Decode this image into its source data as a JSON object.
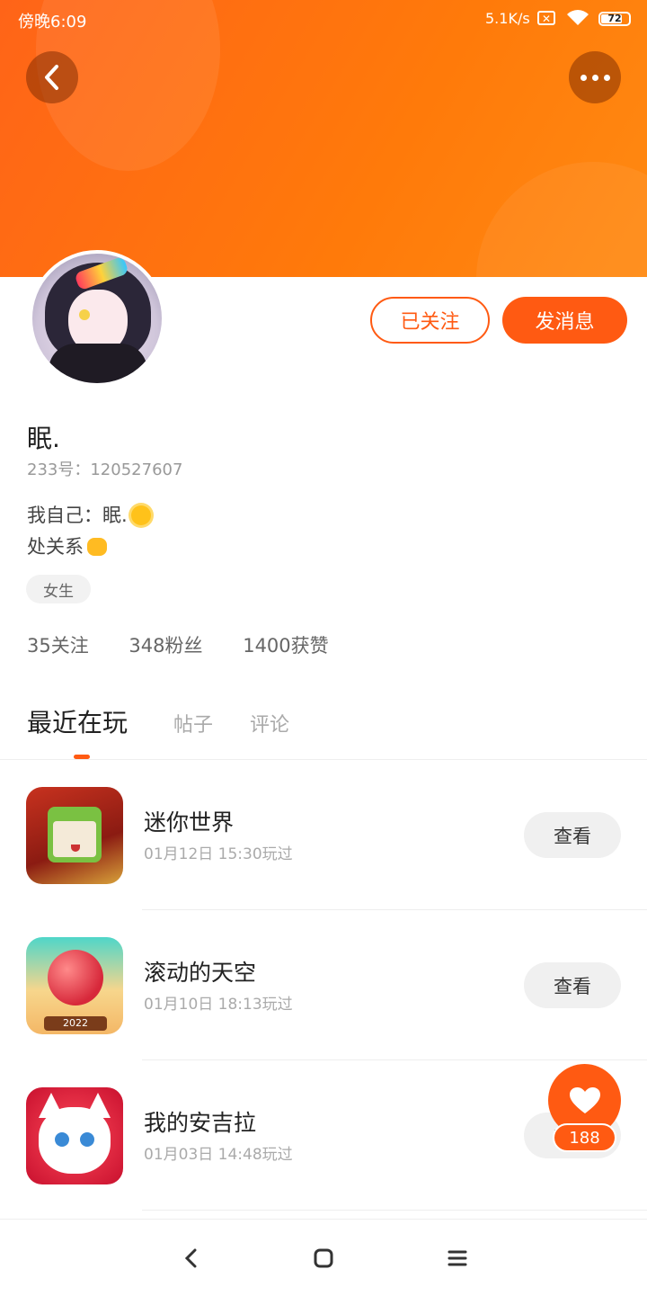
{
  "status_bar": {
    "time": "傍晚6:09",
    "net_speed": "5.1K/s",
    "battery": "72",
    "battery_level": 0.72
  },
  "colors": {
    "accent": "#ff5a12",
    "header": "#ff7a0a"
  },
  "header": {
    "back_icon": "chevron-left-icon",
    "more_icon": "more-dots-icon"
  },
  "profile": {
    "name": "眠.",
    "uid": "233号：120527607",
    "bio_line1": "我自己：眠.",
    "bio_line2": "处关系",
    "gender_tag": "女生",
    "followed_label": "已关注",
    "message_label": "发消息",
    "stats": {
      "following": "35关注",
      "fans": "348粉丝",
      "likes": "1400获赞"
    }
  },
  "tabs": {
    "recent": "最近在玩",
    "posts": "帖子",
    "comments": "评论"
  },
  "games": [
    {
      "title": "迷你世界",
      "time": "01月12日 15:30玩过",
      "button": "查看"
    },
    {
      "title": "滚动的天空",
      "time": "01月10日 18:13玩过",
      "button": "查看",
      "icon_badge": "2022"
    },
    {
      "title": "我的安吉拉",
      "time": "01月03日 14:48玩过",
      "button": "查看"
    }
  ],
  "fab": {
    "icon": "heart-icon",
    "count": "188"
  },
  "navbar": {
    "back": "nav-back-icon",
    "home": "nav-home-icon",
    "menu": "nav-menu-icon"
  }
}
